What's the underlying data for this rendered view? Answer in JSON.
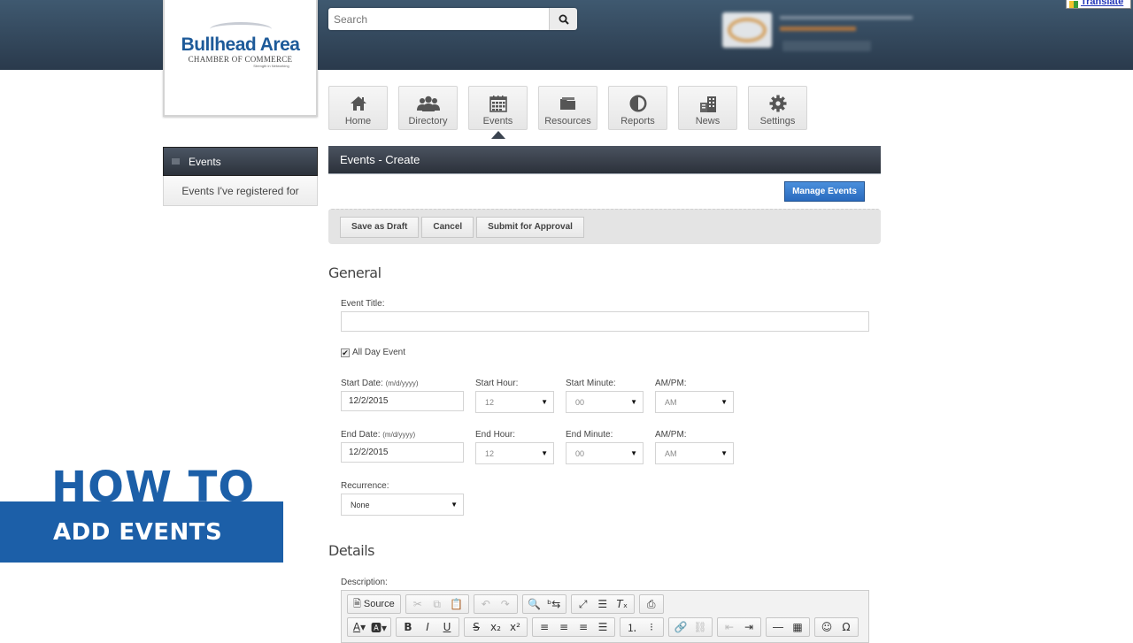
{
  "logo": {
    "main": "Bullhead Area",
    "sub": "CHAMBER OF COMMERCE",
    "tagline": "Strength in Networking"
  },
  "search": {
    "placeholder": "Search"
  },
  "translate": {
    "label": "Translate"
  },
  "nav": {
    "items": [
      {
        "label": "Home",
        "icon": "home-icon"
      },
      {
        "label": "Directory",
        "icon": "people-icon"
      },
      {
        "label": "Events",
        "icon": "calendar-icon",
        "active": true
      },
      {
        "label": "Resources",
        "icon": "folder-icon"
      },
      {
        "label": "Reports",
        "icon": "pie-chart-icon"
      },
      {
        "label": "News",
        "icon": "buildings-icon"
      },
      {
        "label": "Settings",
        "icon": "gear-icon"
      }
    ]
  },
  "sidebar": {
    "header": "Events",
    "items": [
      {
        "label": "Events I've registered for"
      }
    ]
  },
  "page": {
    "title": "Events - Create",
    "manage_button": "Manage Events",
    "actions": {
      "save_draft": "Save as Draft",
      "cancel": "Cancel",
      "submit": "Submit for Approval"
    }
  },
  "general": {
    "section_title": "General",
    "event_title_label": "Event Title:",
    "event_title_value": "",
    "all_day_label": "All Day Event",
    "all_day_checked": true,
    "start_date_label": "Start Date:",
    "date_format_hint": "(m/d/yyyy)",
    "start_date_value": "12/2/2015",
    "start_hour_label": "Start Hour:",
    "start_hour_value": "12",
    "start_minute_label": "Start Minute:",
    "start_minute_value": "00",
    "start_ampm_label": "AM/PM:",
    "start_ampm_value": "AM",
    "end_date_label": "End Date:",
    "end_date_value": "12/2/2015",
    "end_hour_label": "End Hour:",
    "end_hour_value": "12",
    "end_minute_label": "End Minute:",
    "end_minute_value": "00",
    "end_ampm_label": "AM/PM:",
    "end_ampm_value": "AM",
    "recurrence_label": "Recurrence:",
    "recurrence_value": "None"
  },
  "details": {
    "section_title": "Details",
    "description_label": "Description:",
    "toolbar": {
      "source_label": "Source"
    }
  },
  "promo": {
    "line1": "HOW TO",
    "line2": "ADD EVENTS"
  },
  "colors": {
    "header": "#2f4358",
    "brand_blue": "#1c5fa8",
    "button_blue": "#3a7fd0",
    "bar_dark": "#3b4450"
  }
}
